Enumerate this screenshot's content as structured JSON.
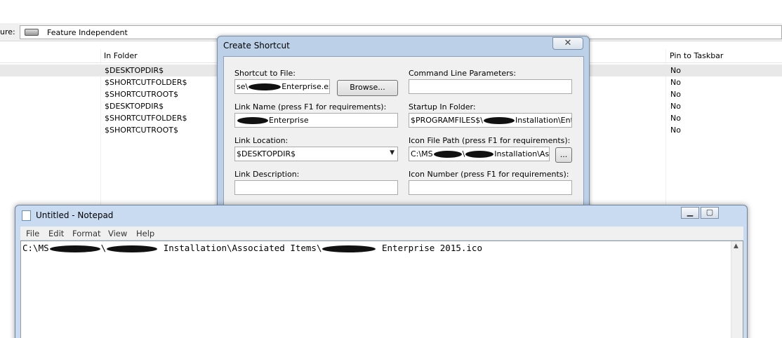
{
  "background": {
    "feature_label": "ure:",
    "feature_value": "Feature Independent",
    "columns": {
      "in_folder": "In Folder",
      "pin_to_taskbar": "Pin to Taskbar"
    },
    "rows": [
      {
        "folder": "$DESKTOPDIR$",
        "pin": "No"
      },
      {
        "folder": "$SHORTCUTFOLDER$",
        "pin": "No"
      },
      {
        "folder": "$SHORTCUTROOT$",
        "pin": "No"
      },
      {
        "folder": "$DESKTOPDIR$",
        "pin": "No"
      },
      {
        "folder": "$SHORTCUTFOLDER$",
        "pin": "No"
      },
      {
        "folder": "$SHORTCUTROOT$",
        "pin": "No"
      }
    ]
  },
  "dialog": {
    "title": "Create Shortcut",
    "close_glyph": "✕",
    "shortcut_to_file_label": "Shortcut to File:",
    "shortcut_to_file_prefix": "se\\",
    "shortcut_to_file_suffix": "Enterprise.exe",
    "browse_label": "Browse...",
    "command_line_label": "Command Line Parameters:",
    "command_line_value": "",
    "link_name_label": "Link Name (press F1 for requirements):",
    "link_name_suffix": "Enterprise",
    "startup_label": "Startup In Folder:",
    "startup_prefix": "$PROGRAMFILES$\\",
    "startup_suffix": "Installation\\Enterp",
    "link_location_label": "Link Location:",
    "link_location_value": "$DESKTOPDIR$",
    "icon_path_label": "Icon File Path (press F1 for requirements):",
    "icon_path_prefix": "C:\\MS",
    "icon_path_middle": "\\",
    "icon_path_suffix": "Installation\\Ass",
    "icon_browse_label": "...",
    "link_description_label": "Link Description:",
    "link_description_value": "",
    "icon_number_label": "Icon Number (press F1 for requirements):",
    "icon_number_value": ""
  },
  "notepad": {
    "title": "Untitled - Notepad",
    "minimize_glyph": "▁",
    "maximize_glyph": "▢",
    "menu": [
      "File",
      "Edit",
      "Format",
      "View",
      "Help"
    ],
    "text_prefix": "C:\\MS",
    "text_sep1": "\\",
    "text_middle": " Installation\\Associated Items\\",
    "text_suffix": " Enterprise 2015.ico"
  }
}
